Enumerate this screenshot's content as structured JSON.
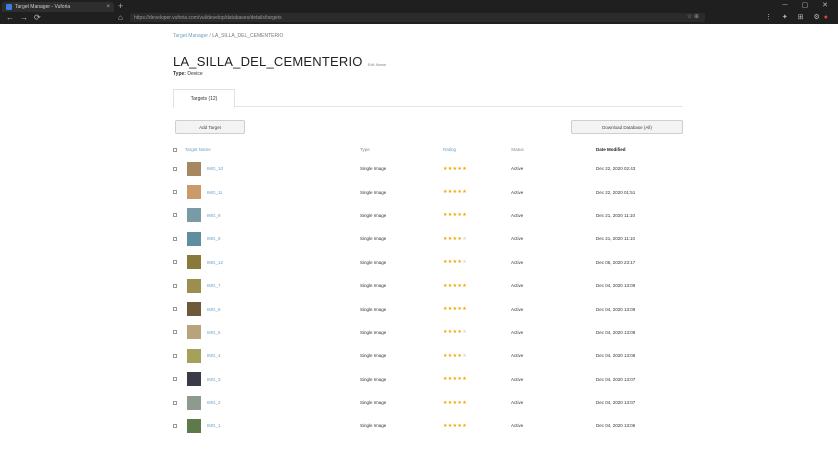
{
  "browser": {
    "tab_title": "Target Manager - Vuforia",
    "tab_close": "×",
    "new_tab": "+",
    "window_controls": "─ ▢ ✕",
    "nav_back": "←",
    "nav_forward": "→",
    "nav_reload": "⟳",
    "nav_home": "⌂",
    "url": "https://developer.vuforia.com/vui/develop/databases/details/targets",
    "addr_icons": "☆ ⊕",
    "toolbar_icons": "⋮ ✦ ⊞ ⚙",
    "toolbar_ext": "●"
  },
  "page": {
    "breadcrumb_root": "Target Manager",
    "breadcrumb_sep": " / ",
    "breadcrumb_current": "LA_SILLA_DEL_CEMENTERIO",
    "title": "LA_SILLA_DEL_CEMENTERIO",
    "title_edit": "Edit Name",
    "type_label": "Type:",
    "type_value": "Device",
    "tab_targets": "Targets (12)",
    "add_target": "Add Target",
    "download_database": "Download Database (All)"
  },
  "table": {
    "headers": {
      "name": "Target Name",
      "type": "Type",
      "rating": "Rating",
      "status": "Status",
      "date": "Date Modified"
    },
    "rows": [
      {
        "name": "IMG_10",
        "type": "Single Image",
        "rating": 5,
        "status": "Active",
        "date": "Dec 22, 2020 02:43",
        "thumb": "#a78760"
      },
      {
        "name": "IMG_11",
        "type": "Single Image",
        "rating": 5,
        "status": "Active",
        "date": "Dec 22, 2020 01:51",
        "thumb": "#c99b6a"
      },
      {
        "name": "IMG_9",
        "type": "Single Image",
        "rating": 5,
        "status": "Active",
        "date": "Dec 21, 2020 11:10",
        "thumb": "#7a9aa8"
      },
      {
        "name": "IMG_8",
        "type": "Single Image",
        "rating": 4,
        "status": "Active",
        "date": "Dec 21, 2020 11:10",
        "thumb": "#5e8fa0"
      },
      {
        "name": "IMG_12",
        "type": "Single Image",
        "rating": 4,
        "status": "Active",
        "date": "Dec 06, 2020 23:17",
        "thumb": "#8a7a3a"
      },
      {
        "name": "IMG_7",
        "type": "Single Image",
        "rating": 5,
        "status": "Active",
        "date": "Dec 04, 2020 13:09",
        "thumb": "#9c8e4e"
      },
      {
        "name": "IMG_6",
        "type": "Single Image",
        "rating": 5,
        "status": "Active",
        "date": "Dec 04, 2020 13:09",
        "thumb": "#6e5a3a"
      },
      {
        "name": "IMG_5",
        "type": "Single Image",
        "rating": 4,
        "status": "Active",
        "date": "Dec 04, 2020 13:08",
        "thumb": "#b9a37a"
      },
      {
        "name": "IMG_4",
        "type": "Single Image",
        "rating": 4,
        "status": "Active",
        "date": "Dec 04, 2020 13:08",
        "thumb": "#a5a05a"
      },
      {
        "name": "IMG_3",
        "type": "Single Image",
        "rating": 5,
        "status": "Active",
        "date": "Dec 04, 2020 13:07",
        "thumb": "#3b3b48"
      },
      {
        "name": "IMG_2",
        "type": "Single Image",
        "rating": 5,
        "status": "Active",
        "date": "Dec 04, 2020 13:07",
        "thumb": "#8f9a8e"
      },
      {
        "name": "IMG_1",
        "type": "Single Image",
        "rating": 5,
        "status": "Active",
        "date": "Dec 04, 2020 13:06",
        "thumb": "#5f7a4a"
      }
    ]
  },
  "colors": {
    "link": "#6aa0c8",
    "star": "#f0a500"
  }
}
